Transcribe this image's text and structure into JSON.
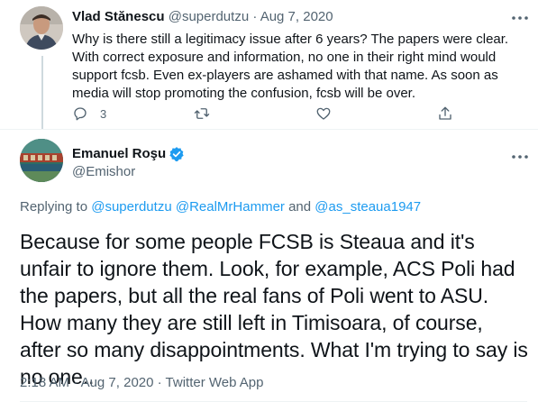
{
  "parent": {
    "name": "Vlad Stănescu",
    "handle": "@superdutzu",
    "separator": "·",
    "date": "Aug 7, 2020",
    "text": "Why is there still a legitimacy issue after 6 years? The papers were clear. With correct exposure and information, no one in their right mind would support fcsb. Even ex-players are ashamed with that name. As soon as media will stop promoting the confusion, fcsb will be over.",
    "reply_count": "3"
  },
  "main": {
    "name": "Emanuel Roşu",
    "handle": "@Emishor",
    "replying_prefix": "Replying to",
    "reply_to_1": "@superdutzu",
    "reply_to_2": "@RealMrHammer",
    "reply_conjunction": "and",
    "reply_to_3": "@as_steaua1947",
    "text": "Because for some people FCSB is Steaua and it's unfair to ignore them. Look, for example, ACS Poli had the papers, but all the real fans of Poli went to ASU. How many they are still left in Timisoara, of course, after so many disappointments. What I'm trying to say is no one..",
    "time": "2:18 AM",
    "separator": "·",
    "date": "Aug 7, 2020",
    "source": "Twitter Web App"
  },
  "colors": {
    "link": "#1d9bf0",
    "muted": "#536471",
    "text": "#0f1419"
  }
}
